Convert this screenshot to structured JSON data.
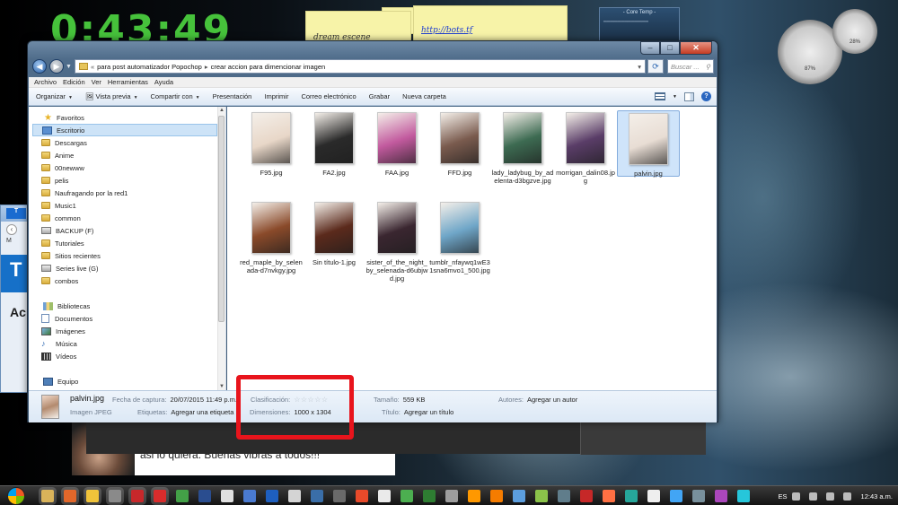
{
  "desktop": {
    "clock": "0:43:49",
    "note_left": "dream escene",
    "note_right": "http://bots.tf",
    "coretemp_title": "- Core Temp -",
    "gauge_1": "87%",
    "gauge_2": "28%"
  },
  "background_window": {
    "tab_label": "T",
    "menu_text": "M",
    "banner_text": "T",
    "heading_text": "Ac",
    "body_text": "asi lo quiera. Buenas vibras a todos!!!"
  },
  "explorer": {
    "caption": {
      "minimize": "–",
      "maximize": "□",
      "close": "✕"
    },
    "address": {
      "segments": [
        "para post automatizador Popochop",
        "crear accion para dimencionar imagen"
      ],
      "search_placeholder": "Buscar ..."
    },
    "menu": [
      "Archivo",
      "Edición",
      "Ver",
      "Herramientas",
      "Ayuda"
    ],
    "commands": {
      "organize": "Organizar",
      "preview": "Vista previa",
      "share": "Compartir con",
      "slideshow": "Presentación",
      "print": "Imprimir",
      "email": "Correo electrónico",
      "burn": "Grabar",
      "new_folder": "Nueva carpeta"
    },
    "nav": {
      "favorites": "Favoritos",
      "items": [
        "Escritorio",
        "Descargas",
        "Anime",
        "00newww",
        "pelis",
        "Naufragando por la red1",
        "Music1",
        "common",
        "BACKUP (F)",
        "Tutoriales",
        "Sitios recientes",
        "Series live (G)",
        "combos"
      ],
      "libraries": "Bibliotecas",
      "library_items": [
        "Documentos",
        "Imágenes",
        "Música",
        "Vídeos"
      ],
      "computer": "Equipo"
    },
    "files": [
      {
        "name": "F95.jpg",
        "thumb_color": "#e8d7c8"
      },
      {
        "name": "FA2.jpg",
        "thumb_color": "#2a2a2a"
      },
      {
        "name": "FAA.jpg",
        "thumb_color": "#c25a9e"
      },
      {
        "name": "FFD.jpg",
        "thumb_color": "#7a5b4e"
      },
      {
        "name": "lady_ladybug_by_adelenta-d3bgzve.jpg",
        "thumb_color": "#3d6b52"
      },
      {
        "name": "morrigan_dalin08.jpg",
        "thumb_color": "#5a3d68"
      },
      {
        "name": "palvin.jpg",
        "thumb_color": "#e8ddd4"
      },
      {
        "name": "red_maple_by_selenada-d7nvkgy.jpg",
        "thumb_color": "#8a4a2a"
      },
      {
        "name": "Sin título-1.jpg",
        "thumb_color": "#5b2a1c"
      },
      {
        "name": "sister_of_the_night_by_selenada-d6ubjwd.jpg",
        "thumb_color": "#3a2630"
      },
      {
        "name": "tumblr_nfaywq1wE31sna6mvo1_500.jpg",
        "thumb_color": "#6fa6c8"
      }
    ],
    "details": {
      "name": "palvin.jpg",
      "type": "Imagen JPEG",
      "date_label": "Fecha de captura:",
      "date_value": "20/07/2015 11:49 p.m.",
      "tags_label": "Etiquetas:",
      "tags_value": "Agregar una etiqueta",
      "rating_label": "Clasificación:",
      "rating_stars": "☆☆☆☆☆",
      "dimensions_label": "Dimensiones:",
      "dimensions_value": "1000 x 1304",
      "size_label": "Tamaño:",
      "size_value": "559 KB",
      "title_label": "Título:",
      "title_value": "Agregar un título",
      "authors_label": "Autores:",
      "authors_value": "Agregar un autor"
    }
  },
  "taskbar": {
    "language": "ES",
    "time": "12:43 a.m.",
    "icon_colors": [
      "#d9b35a",
      "#e2672a",
      "#f0c33a",
      "#8a8a8a",
      "#c7282b",
      "#d92c2c",
      "#43a047",
      "#2a4d8f",
      "#e0e0e0",
      "#4a7ad0",
      "#1e5fbf",
      "#d4d4d4",
      "#3a6ea8",
      "#6a6a6a",
      "#e84a2a",
      "#eaeaea",
      "#4caf50",
      "#2e7d32",
      "#9e9e9e",
      "#ff9800",
      "#f57c00",
      "#5c9ede",
      "#8bc34a",
      "#607d8b",
      "#c62828",
      "#ff7043",
      "#26a69a",
      "#eeeeee",
      "#42a5f5",
      "#78909c",
      "#ab47bc",
      "#26c6da"
    ]
  }
}
